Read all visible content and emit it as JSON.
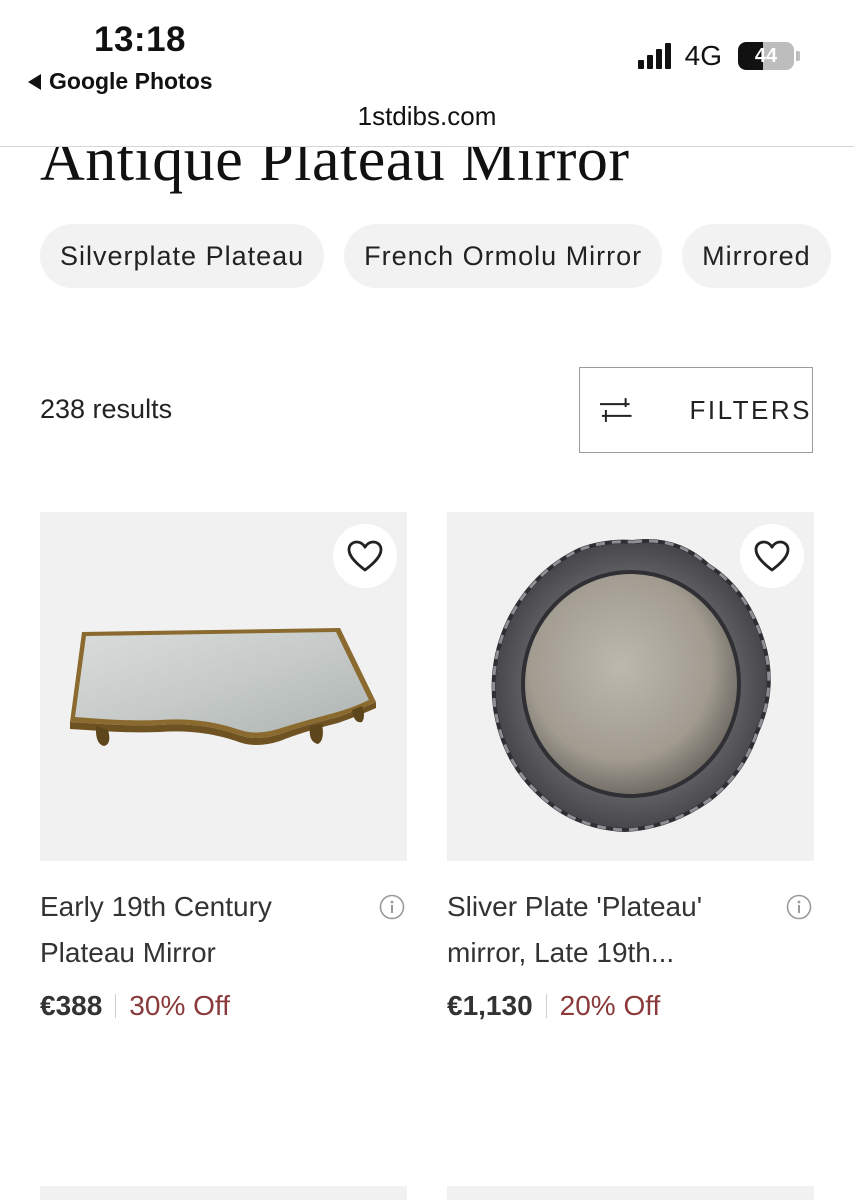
{
  "status": {
    "time": "13:18",
    "back_label": "Google Photos",
    "network": "4G",
    "battery": "44",
    "battery_level": 0.44
  },
  "browser": {
    "url": "1stdibs.com"
  },
  "page": {
    "title": "Antique Plateau Mirror",
    "chips": [
      "Silverplate Plateau",
      "French Ormolu Mirror",
      "Mirrored"
    ],
    "results_count": "238 results",
    "filters_label": "FILTERS"
  },
  "products": [
    {
      "title": "Early 19th Century Plateau Mirror",
      "price": "€388",
      "discount": "30% Off",
      "image": "rectangular gilt-bronze plateau mirror"
    },
    {
      "title": "Sliver Plate 'Plateau' mirror, Late 19th...",
      "price": "€1,130",
      "discount": "20% Off",
      "image": "round silver plateau mirror with textured frame"
    }
  ],
  "colors": {
    "discount": "#8a3a3a",
    "chip_bg": "#f2f2f2",
    "card_bg": "#f1f1f1"
  },
  "icons": [
    "back-arrow-icon",
    "signal-icon",
    "battery-icon",
    "filters-icon",
    "heart-icon",
    "info-icon"
  ]
}
